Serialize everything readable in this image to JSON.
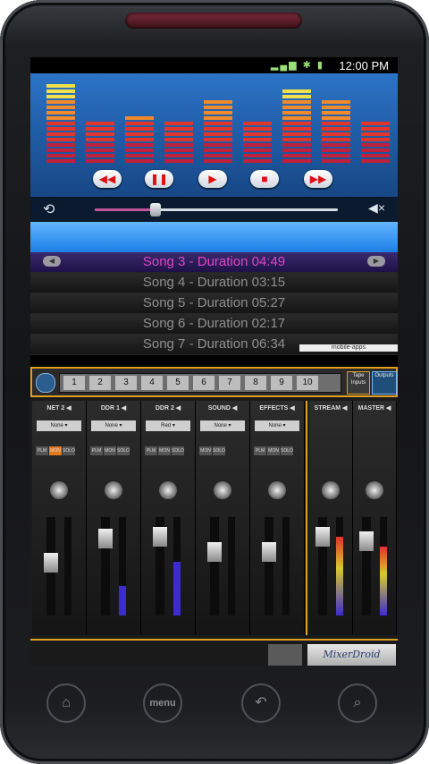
{
  "statusbar": {
    "time": "12:00 PM",
    "icons": "wifi signal battery"
  },
  "equalizer": {
    "levels": [
      0.95,
      0.5,
      0.55,
      0.5,
      0.72,
      0.5,
      0.85,
      0.72,
      0.52
    ]
  },
  "transport": {
    "buttons": [
      {
        "name": "rewind",
        "glyph": "◀◀"
      },
      {
        "name": "pause",
        "glyph": "❚❚"
      },
      {
        "name": "play",
        "glyph": "▶"
      },
      {
        "name": "stop",
        "glyph": "■"
      },
      {
        "name": "fast-forward",
        "glyph": "▶▶"
      }
    ],
    "repeat_glyph": "⟲",
    "mute_glyph": "◀×",
    "progress": 0.25
  },
  "playlist": {
    "songs": [
      "Song 3 - Duration 04:49",
      "Song 4 - Duration 03:15",
      "Song 5 - Duration 05:27",
      "Song 6 - Duration 02:17",
      "Song 7 - Duration 06:34"
    ],
    "active_index": 0,
    "watermark": "mobile-apps"
  },
  "mixer": {
    "channel_numbers": [
      "1",
      "2",
      "3",
      "4",
      "5",
      "6",
      "7",
      "8",
      "9",
      "10"
    ],
    "tape_label": "Tape Inputs",
    "outputs_label": "Outputs",
    "strips": [
      {
        "name": "NET 2",
        "select": "None",
        "mini": [
          "PLM",
          "MON",
          "SOLO"
        ],
        "mini_on": 1,
        "fader": 0.55,
        "meter": 0.0
      },
      {
        "name": "DDR 1",
        "select": "None",
        "mini": [
          "PLM",
          "MON",
          "SOLO"
        ],
        "mini_on": -1,
        "fader": 0.85,
        "meter": 0.3
      },
      {
        "name": "DDR 2",
        "select": "Red",
        "mini": [
          "PLM",
          "MON",
          "SOLO"
        ],
        "mini_on": -1,
        "fader": 0.88,
        "meter": 0.55
      },
      {
        "name": "SOUND",
        "select": "None",
        "mini": [
          "MON",
          "SOLO"
        ],
        "mini_on": -1,
        "fader": 0.68,
        "meter": 0.0
      },
      {
        "name": "EFFECTS",
        "select": "None",
        "mini": [
          "PLM",
          "MON",
          "SOLO"
        ],
        "mini_on": -1,
        "fader": 0.68,
        "meter": 0.0
      }
    ],
    "masters": [
      {
        "name": "STREAM",
        "fader": 0.88,
        "meter": 0.8
      },
      {
        "name": "MASTER",
        "fader": 0.82,
        "meter": 0.7
      }
    ],
    "brand": "MixerDroid"
  },
  "hardware": {
    "menu_label": "menu",
    "home": "⌂",
    "back": "↶",
    "search": "⌕"
  }
}
